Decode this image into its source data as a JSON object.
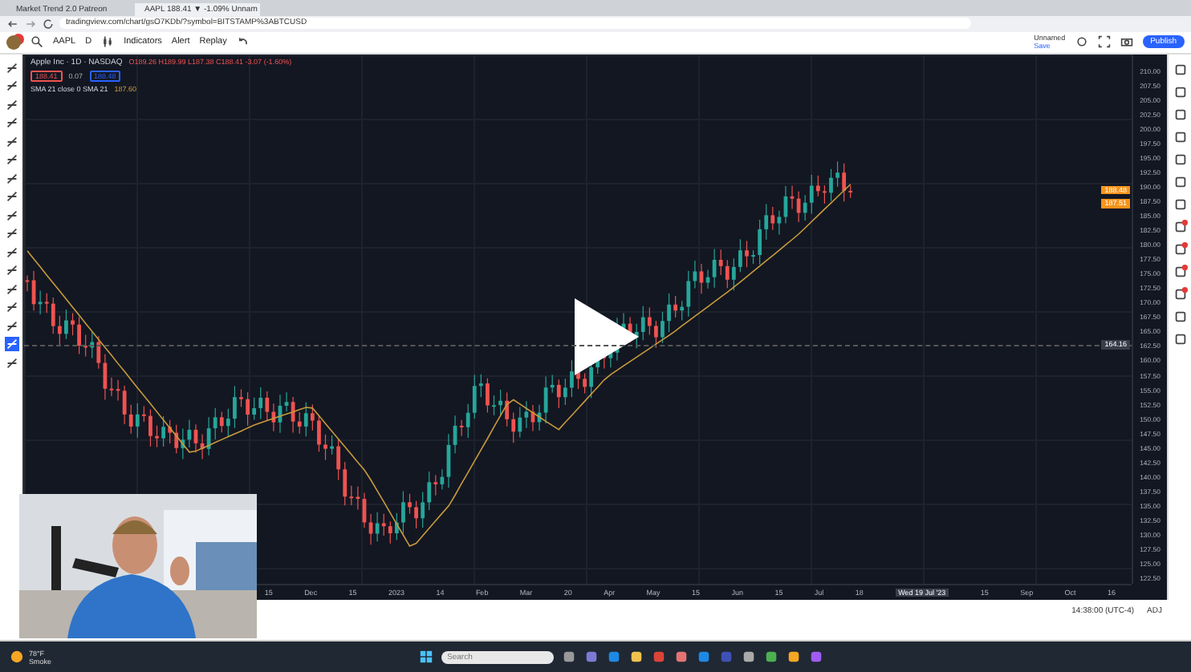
{
  "browser": {
    "tabs": [
      {
        "title": "Market Trend 2.0 Patreon",
        "selected": false
      },
      {
        "title": "AAPL 188.41 ▼ -1.09% Unnam",
        "selected": true
      }
    ],
    "address": "tradingview.com/chart/gsO7KDb/?symbol=BITSTAMP%3ABTCUSD"
  },
  "toolbar": {
    "symbol": "AAPL",
    "interval": "D",
    "buttons": [
      "Indicators",
      "Alert",
      "Replay"
    ],
    "layout_name": "Unnamed",
    "layout_status": "Save",
    "publish": "Publish"
  },
  "left_tools": [
    {
      "selected": false
    },
    {
      "selected": false
    },
    {
      "selected": false
    },
    {
      "selected": false
    },
    {
      "selected": false
    },
    {
      "selected": false
    },
    {
      "selected": false
    },
    {
      "selected": false
    },
    {
      "selected": false
    },
    {
      "selected": false
    },
    {
      "selected": false
    },
    {
      "selected": false
    },
    {
      "selected": false
    },
    {
      "selected": false
    },
    {
      "selected": false
    },
    {
      "selected": true
    },
    {
      "selected": false
    }
  ],
  "legend": {
    "title": "Apple Inc · 1D · NASDAQ",
    "ohlc": "O189.26 H189.99 L187.38 C188.41 -3.07 (-1.60%)",
    "sell": "188.41",
    "spread": "0.07",
    "buy": "188.48",
    "indicator": "SMA 21 close 0 SMA 21",
    "indicator_value": "187.60"
  },
  "price_axis": [
    "210.00",
    "207.50",
    "205.00",
    "202.50",
    "200.00",
    "197.50",
    "195.00",
    "192.50",
    "190.00",
    "187.50",
    "185.00",
    "182.50",
    "180.00",
    "177.50",
    "175.00",
    "172.50",
    "170.00",
    "167.50",
    "165.00",
    "162.50",
    "160.00",
    "157.50",
    "155.00",
    "152.50",
    "150.00",
    "147.50",
    "145.00",
    "142.50",
    "140.00",
    "137.50",
    "135.00",
    "132.50",
    "130.00",
    "127.50",
    "125.00",
    "122.50"
  ],
  "price_badges": [
    {
      "label": "188.48",
      "color": "#f7931a"
    },
    {
      "label": "187.51",
      "color": "#f7931a"
    }
  ],
  "crosshair_price": "164.16",
  "time_axis": [
    {
      "label": "15",
      "selected": false
    },
    {
      "label": "Dec",
      "selected": false
    },
    {
      "label": "15",
      "selected": false
    },
    {
      "label": "2023",
      "selected": false
    },
    {
      "label": "14",
      "selected": false
    },
    {
      "label": "Feb",
      "selected": false
    },
    {
      "label": "Mar",
      "selected": false
    },
    {
      "label": "20",
      "selected": false
    },
    {
      "label": "Apr",
      "selected": false
    },
    {
      "label": "May",
      "selected": false
    },
    {
      "label": "15",
      "selected": false
    },
    {
      "label": "Jun",
      "selected": false
    },
    {
      "label": "15",
      "selected": false
    },
    {
      "label": "Jul",
      "selected": false
    },
    {
      "label": "18",
      "selected": false
    },
    {
      "label": "Wed 19 Jul '23",
      "selected": true
    },
    {
      "label": "15",
      "selected": false
    },
    {
      "label": "Sep",
      "selected": false
    },
    {
      "label": "Oct",
      "selected": false
    },
    {
      "label": "16",
      "selected": false
    }
  ],
  "status": {
    "time": "14:38:00 (UTC-4)",
    "adj": "ADJ"
  },
  "taskbar": {
    "temperature": "78°F",
    "weather": "Smoke",
    "search_placeholder": "Search"
  }
}
